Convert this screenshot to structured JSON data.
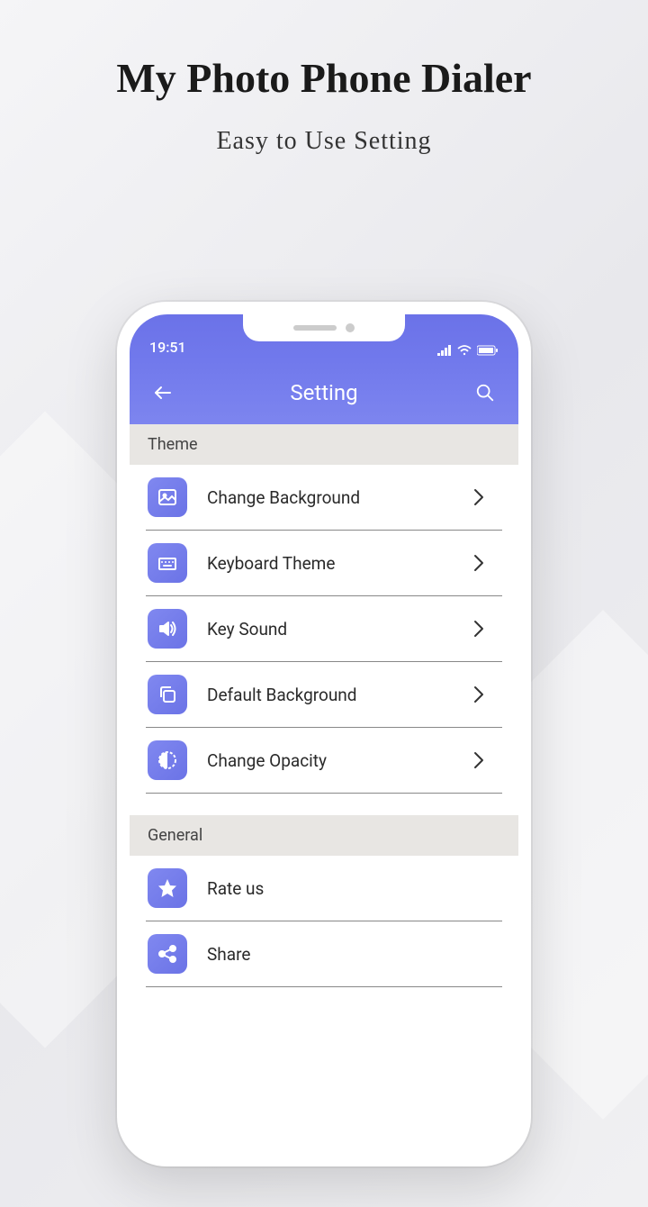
{
  "promo": {
    "title": "My Photo Phone Dialer",
    "subtitle": "Easy to Use Setting"
  },
  "status": {
    "time": "19:51"
  },
  "header": {
    "title": "Setting"
  },
  "sections": [
    {
      "title": "Theme",
      "items": [
        {
          "label": "Change Background",
          "icon": "image",
          "chevron": true
        },
        {
          "label": "Keyboard Theme",
          "icon": "keyboard",
          "chevron": true
        },
        {
          "label": "Key Sound",
          "icon": "sound",
          "chevron": true
        },
        {
          "label": "Default Background",
          "icon": "copy",
          "chevron": true
        },
        {
          "label": "Change Opacity",
          "icon": "opacity",
          "chevron": true
        }
      ]
    },
    {
      "title": "General",
      "items": [
        {
          "label": "Rate us",
          "icon": "star",
          "chevron": false
        },
        {
          "label": "Share",
          "icon": "share",
          "chevron": false
        }
      ]
    }
  ]
}
